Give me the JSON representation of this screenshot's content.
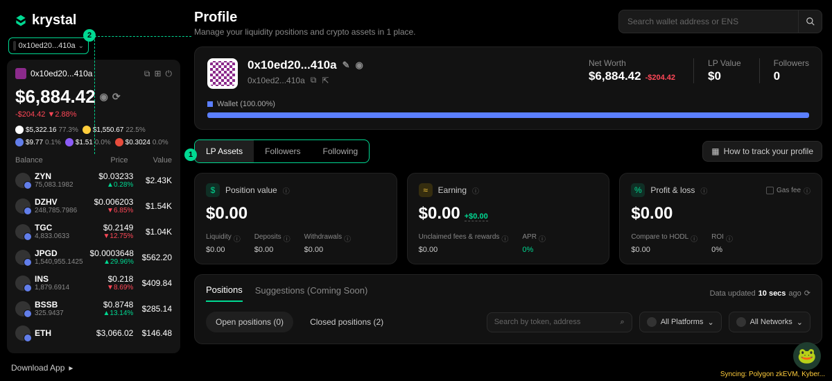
{
  "brand": "krystal",
  "walletSelector": {
    "addr": "0x10ed20...410a"
  },
  "badges": {
    "one": "1",
    "two": "2"
  },
  "sidepanel": {
    "addr": "0x10ed20...410a",
    "total": "$6,884.42",
    "delta": "-$204.42 ▼2.88%",
    "chips": [
      {
        "color": "#fff",
        "val": "$5,322.16",
        "pct": "77.3%"
      },
      {
        "color": "#ffcd3c",
        "val": "$1,550.67",
        "pct": "22.5%"
      },
      {
        "color": "#627eea",
        "val": "$9.77",
        "pct": "0.1%"
      },
      {
        "color": "#8b5cf6",
        "val": "$1.51",
        "pct": "0.0%"
      },
      {
        "color": "#e74c3c",
        "val": "$0.3024",
        "pct": "0.0%"
      }
    ],
    "headers": {
      "balance": "Balance",
      "price": "Price",
      "value": "Value"
    },
    "rows": [
      {
        "sym": "ZYN",
        "qty": "75,083.1982",
        "price": "$0.03233",
        "chg": "▲0.28%",
        "dir": "up",
        "val": "$2.43K"
      },
      {
        "sym": "DZHV",
        "qty": "248,785.7986",
        "price": "$0.006203",
        "chg": "▼6.85%",
        "dir": "down",
        "val": "$1.54K"
      },
      {
        "sym": "TGC",
        "qty": "4,833.0633",
        "price": "$0.2149",
        "chg": "▼12.75%",
        "dir": "down",
        "val": "$1.04K"
      },
      {
        "sym": "JPGD",
        "qty": "1,540,955.1425",
        "price": "$0.0003648",
        "chg": "▲29.96%",
        "dir": "up",
        "val": "$562.20"
      },
      {
        "sym": "INS",
        "qty": "1,879.6914",
        "price": "$0.218",
        "chg": "▼8.69%",
        "dir": "down",
        "val": "$409.84"
      },
      {
        "sym": "BSSB",
        "qty": "325.9437",
        "price": "$0.8748",
        "chg": "▲13.14%",
        "dir": "up",
        "val": "$285.14"
      },
      {
        "sym": "ETH",
        "qty": "",
        "price": "$3,066.02",
        "chg": "",
        "dir": "",
        "val": "$146.48"
      }
    ]
  },
  "downloadApp": "Download App",
  "header": {
    "title": "Profile",
    "subtitle": "Manage your liquidity positions and crypto assets in 1 place.",
    "searchPlaceholder": "Search wallet address or ENS"
  },
  "profile": {
    "name": "0x10ed20...410a",
    "addr": "0x10ed2...410a",
    "stats": {
      "networth": {
        "label": "Net Worth",
        "value": "$6,884.42",
        "delta": "-$204.42"
      },
      "lpvalue": {
        "label": "LP Value",
        "value": "$0"
      },
      "followers": {
        "label": "Followers",
        "value": "0"
      }
    },
    "alloc": "Wallet (100.00%)"
  },
  "tabs": {
    "lp": "LP Assets",
    "followers": "Followers",
    "following": "Following"
  },
  "howto": "How to track your profile",
  "metrics": {
    "position": {
      "title": "Position value",
      "value": "$0.00",
      "sub": [
        {
          "l": "Liquidity",
          "v": "$0.00"
        },
        {
          "l": "Deposits",
          "v": "$0.00"
        },
        {
          "l": "Withdrawals",
          "v": "$0.00"
        }
      ]
    },
    "earning": {
      "title": "Earning",
      "value": "$0.00",
      "plus": "+$0.00",
      "sub": [
        {
          "l": "Unclaimed fees & rewards",
          "v": "$0.00"
        },
        {
          "l": "APR",
          "v": "0%",
          "green": true
        }
      ]
    },
    "pnl": {
      "title": "Profit & loss",
      "value": "$0.00",
      "gas": "Gas fee",
      "sub": [
        {
          "l": "Compare to HODL",
          "v": "$0.00"
        },
        {
          "l": "ROI",
          "v": "0%"
        }
      ]
    }
  },
  "positions": {
    "tabs": {
      "positions": "Positions",
      "suggestions": "Suggestions (Coming Soon)"
    },
    "updated": {
      "prefix": "Data updated",
      "time": "10 secs",
      "suffix": "ago"
    },
    "filters": {
      "open": "Open positions (0)",
      "closed": "Closed positions (2)",
      "searchPlaceholder": "Search by token, address",
      "platforms": "All Platforms",
      "networks": "All Networks"
    }
  },
  "sync": "Syncing: Polygon zkEVM, Kyber..."
}
